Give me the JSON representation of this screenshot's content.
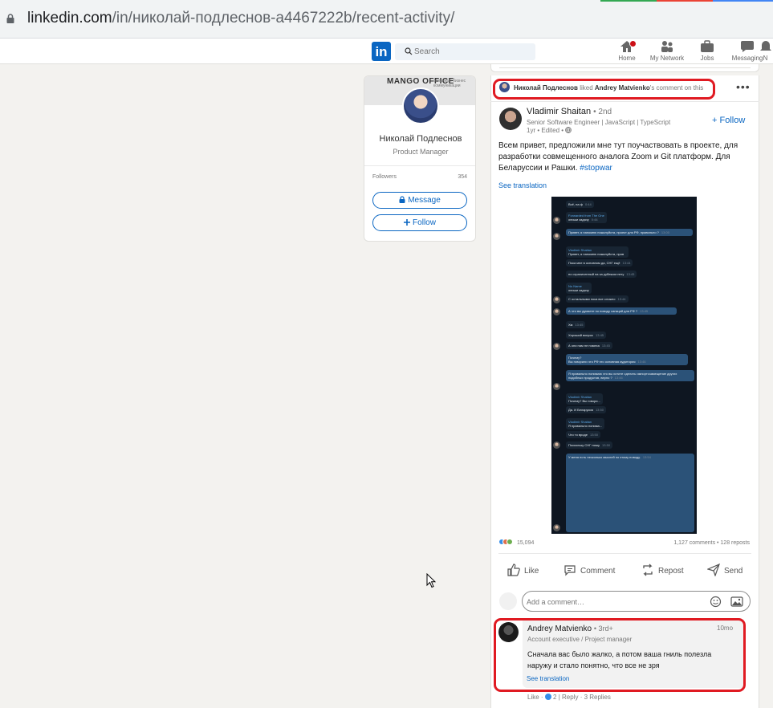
{
  "browser": {
    "url_host": "linkedin.com",
    "url_path": "/in/николай-подлеснов-a4467222b/recent-activity/"
  },
  "nav": {
    "logo": "in",
    "search_placeholder": "Search",
    "items": [
      {
        "label": "Home",
        "icon": "home-icon",
        "badge": true
      },
      {
        "label": "My Network",
        "icon": "network-icon"
      },
      {
        "label": "Jobs",
        "icon": "briefcase-icon"
      },
      {
        "label": "Messaging",
        "icon": "messaging-icon"
      },
      {
        "label": "N",
        "icon": "bell-icon"
      }
    ]
  },
  "profile": {
    "cover_brand": "MANGO OFFICE",
    "cover_tagline": "облачные бизнес коммуникации",
    "name": "Николай Подлеснов",
    "title": "Product Manager",
    "followers_label": "Followers",
    "followers_count": "354",
    "message_label": "Message",
    "follow_label": "Follow"
  },
  "activity": {
    "actor": "Николай Подлеснов",
    "verb": "liked",
    "target": "Andrey Matvienko",
    "suffix": "'s comment on this"
  },
  "post": {
    "author": "Vladimir Shaitan",
    "degree": "• 2nd",
    "headline": "Senior Software Engineer | JavaScript | TypeScript",
    "meta": "1yr • Edited •",
    "follow_label": "+ Follow",
    "text": "Всем привет, предложили мне тут поучаствовать в проекте, для разработки совмещенного аналога Zoom и Git платформ. Для Беларуссии и Рашки.",
    "hashtag": "#stopwar",
    "see_translation": "See translation",
    "reactions_count": "15,094",
    "comments_reposts": "1,127 comments • 128 reposts",
    "actions": [
      "Like",
      "Comment",
      "Repost",
      "Send"
    ]
  },
  "chat_image": {
    "messages": [
      {
        "text": "Всё, на ф",
        "time": "0:44",
        "out": false
      },
      {
        "fwd": "Forwarded from The One",
        "text": "опиши задачу",
        "time": "0:44",
        "out": false
      },
      {
        "text": "Привет, я напомню пожалуйста, проект для РФ, правильно ?",
        "time": "13:00",
        "out": true
      },
      {
        "fwd": "Vladimir Shaitan",
        "text": "Привет, я напомню пожалуйста, пров",
        "time": "",
        "out": false
      },
      {
        "text": "Пока мне в основном да, СНГ ещё",
        "time": "13:44",
        "out": false
      },
      {
        "text": "но ограниченный на за рубежом нету",
        "time": "13:45",
        "out": false
      },
      {
        "fwd": "No Name",
        "text": "опиши задачу",
        "time": "",
        "out": false
      },
      {
        "text": "С остальными пока все сложно",
        "time": "13:44",
        "out": false
      },
      {
        "text": "А что вы думаете по поводу санкций для РФ ?",
        "time": "13:45",
        "out": true
      },
      {
        "text": "Хм",
        "time": "13:45",
        "out": false
      },
      {
        "text": "Хороший вопрос",
        "time": "13:45",
        "out": false
      },
      {
        "text": "А они нам не помеха",
        "time": "13:45",
        "out": false
      },
      {
        "text": "Почему?",
        "time": "",
        "out": true
      },
      {
        "text": "Вы говорили что РФ это основная аудитория",
        "time": "13:46",
        "out": true
      },
      {
        "text": "Я правильно понимаю что вы хотите сделать импортозамещение других подобных продуктов, верно ?",
        "time": "13:46",
        "out": true
      },
      {
        "fwd": "Vladimir Shaitan",
        "text": "Почему? Вы говори...",
        "time": "",
        "out": false
      },
      {
        "text": "Да. И Беларусия",
        "time": "13:50",
        "out": false
      },
      {
        "fwd": "Vladimir Shaitan",
        "text": "Я правильно понима...",
        "time": "",
        "out": false
      },
      {
        "text": "Что то вроде",
        "time": "13:50",
        "out": false
      },
      {
        "text": "Поскольку СНГ пишу",
        "time": "13:50",
        "out": false
      },
      {
        "text": "У меня есть несколько мыслей по этому поводу.",
        "time": "13:54",
        "out": true
      }
    ]
  },
  "comment_input": {
    "placeholder": "Add a comment…"
  },
  "reply": {
    "author": "Andrey Matvienko",
    "degree": "• 3rd+",
    "time": "10mo",
    "headline": "Account executive / Project manager",
    "text": "Сначала вас было жалко, а потом ваша гниль полезла наружу и стало понятно, что все не зря",
    "see_translation": "See translation",
    "like_label": "Like",
    "like_count": "2",
    "reply_label": "Reply",
    "replies": "3 Replies"
  },
  "colors": {
    "accent": "#0a66c2",
    "highlight": "#e01a22",
    "background": "#f3f2ef"
  }
}
